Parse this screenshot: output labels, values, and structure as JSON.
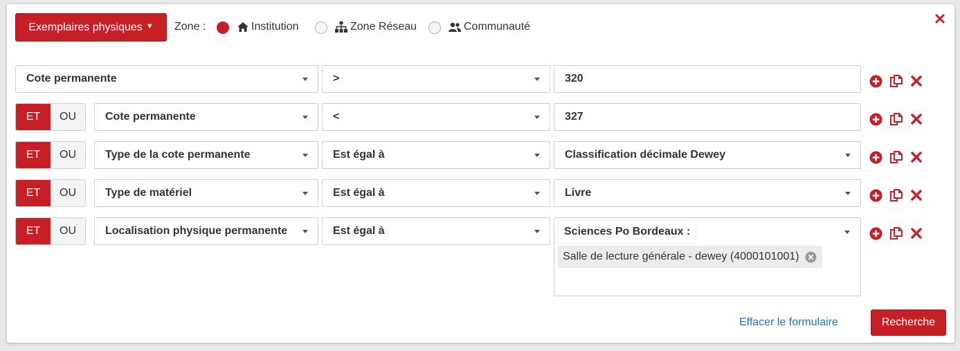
{
  "header": {
    "dropdown_label": "Exemplaires physiques",
    "zone_label": "Zone :",
    "zones": [
      {
        "label": "Institution",
        "selected": true,
        "icon": "home-icon"
      },
      {
        "label": "Zone Réseau",
        "selected": false,
        "icon": "network-icon"
      },
      {
        "label": "Communauté",
        "selected": false,
        "icon": "users-icon"
      }
    ]
  },
  "rows": [
    {
      "field": "Cote permanente",
      "operator": ">",
      "value": "320"
    },
    {
      "connector_et": "ET",
      "connector_ou": "OU",
      "field": "Cote permanente",
      "operator": "<",
      "value": "327"
    },
    {
      "connector_et": "ET",
      "connector_ou": "OU",
      "field": "Type de la cote permanente",
      "operator": "Est égal à",
      "value": "Classification décimale Dewey"
    },
    {
      "connector_et": "ET",
      "connector_ou": "OU",
      "field": "Type de matériel",
      "operator": "Est égal à",
      "value": "Livre"
    },
    {
      "connector_et": "ET",
      "connector_ou": "OU",
      "field": "Localisation physique permanente",
      "operator": "Est égal à",
      "group_label": "Sciences Po Bordeaux :",
      "chip_label": "Salle de lecture générale - dewey (4000101001)"
    }
  ],
  "footer": {
    "clear_label": "Effacer le formulaire",
    "search_label": "Recherche"
  },
  "colors": {
    "accent": "#c62026",
    "link": "#1f74c4"
  }
}
